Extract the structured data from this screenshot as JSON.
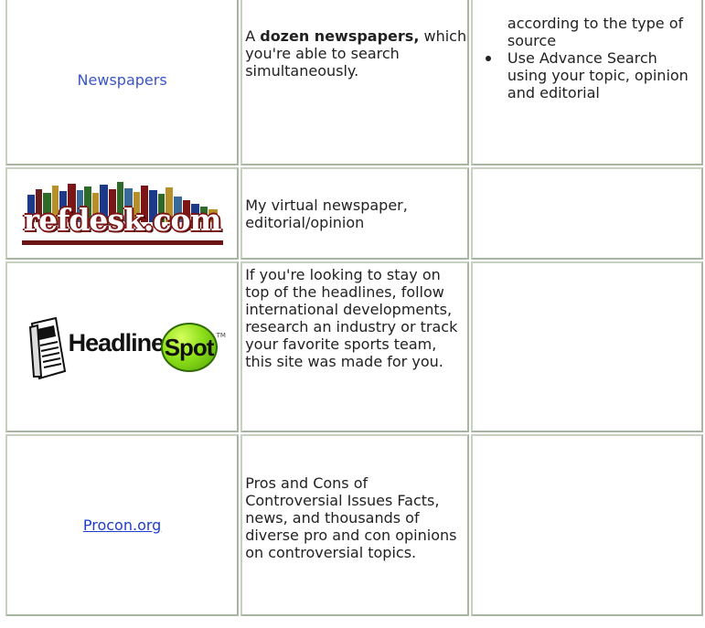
{
  "rows": [
    {
      "resource": {
        "type": "link",
        "label": "Newspapers"
      },
      "description": {
        "prefix": "A ",
        "emphasis": "dozen newspapers,",
        "rest": " which you're able to search simultaneously."
      },
      "tips": {
        "lead_text": "according to the type of source",
        "bullets": [
          "Use Advance Search using your topic, opinion and editorial"
        ]
      }
    },
    {
      "resource": {
        "type": "logo",
        "logo_text": "refdesk.com",
        "alt": "refdesk-logo"
      },
      "description": {
        "text": "My virtual newspaper, editorial/opinion"
      },
      "tips": {
        "text": ""
      }
    },
    {
      "resource": {
        "type": "logo",
        "logo_text_main": "Headline",
        "logo_text_spot": "Spot",
        "logo_tm": "TM",
        "alt": "headlinespot-logo"
      },
      "description": {
        "text": "If you're looking to stay on top of the headlines, follow international developments, research an industry or track your favorite sports team, this site was made for you."
      },
      "tips": {
        "text": ""
      }
    },
    {
      "resource": {
        "type": "link",
        "label": "Procon.org"
      },
      "description": {
        "text": "Pros and Cons of Controversial Issues Facts, news, and thousands of diverse pro and con opinions on controversial topics."
      },
      "tips": {
        "text": ""
      }
    }
  ],
  "colors": {
    "border": "#a8b5a0",
    "link": "#3a55c8",
    "underlined_link": "#1d3fc9",
    "refdesk_maroon": "#7c1616",
    "headlinespot_green": "#8ee01a"
  }
}
